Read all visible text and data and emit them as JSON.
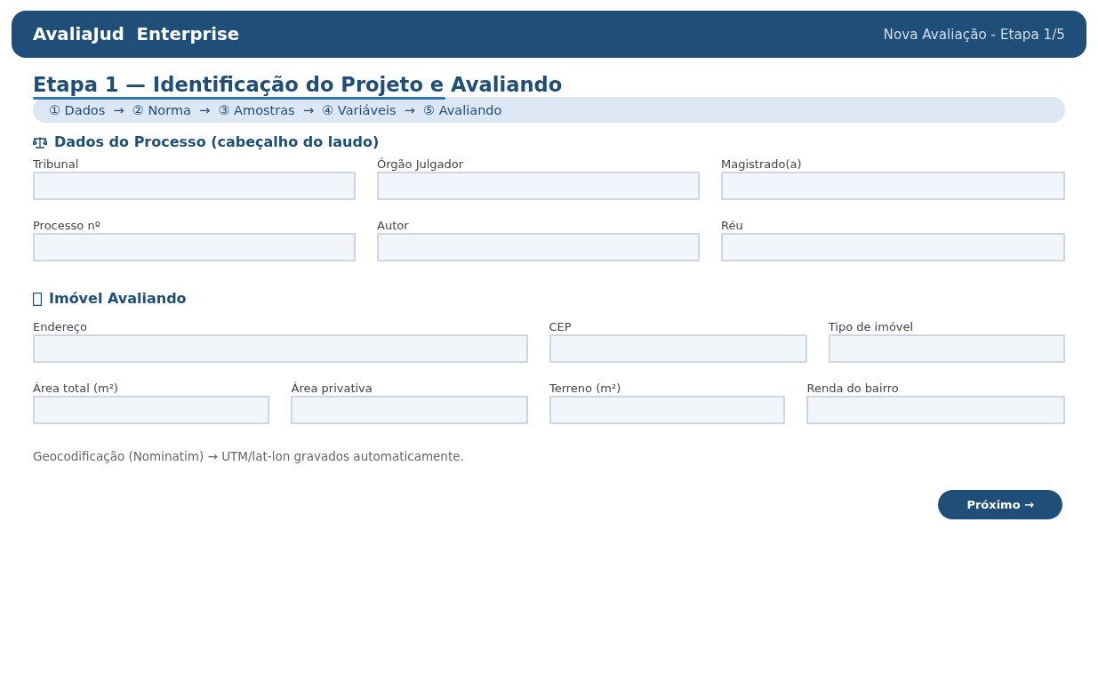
{
  "header": {
    "brand": "AvaliaJud  Enterprise",
    "subtitle": "Nova Avaliação - Etapa 1/5"
  },
  "page_title": "Etapa 1 — Identificação do Projeto e Avaliando",
  "progress": {
    "steps": "① Dados  →  ② Norma  →  ③ Amostras  →  ④ Variáveis  →  ⑤ Avaliando",
    "level": 0.4
  },
  "sections": [
    {
      "kind": "scale",
      "heading": "Dados do Processo (cabeçalho do laudo)",
      "rows": [
        {
          "fields": [
            {
              "label": "Tribunal"
            },
            {
              "label": "Órgão Julgador"
            },
            {
              "label": "Magistrado(a)"
            }
          ]
        },
        {
          "fields": [
            {
              "label": "Processo nº"
            },
            {
              "label": "Autor"
            },
            {
              "label": "Réu"
            }
          ]
        }
      ]
    },
    {
      "kind": "missing-glyph",
      "heading": "Imóvel Avaliando",
      "rows": [
        {
          "fields": [
            {
              "label": "Endereço"
            },
            {
              "label": "CEP"
            },
            {
              "label": "Tipo de imóvel"
            }
          ]
        },
        {
          "fields": [
            {
              "label": "Área total (m²)"
            },
            {
              "label": "Área privativa"
            },
            {
              "label": "Terreno (m²)"
            },
            {
              "label": "Renda do bairro"
            }
          ]
        }
      ]
    }
  ],
  "note": "Geocodificação (Nominatim) → UTM/lat-lon gravados automaticamente.",
  "next_button": "Próximo →"
}
